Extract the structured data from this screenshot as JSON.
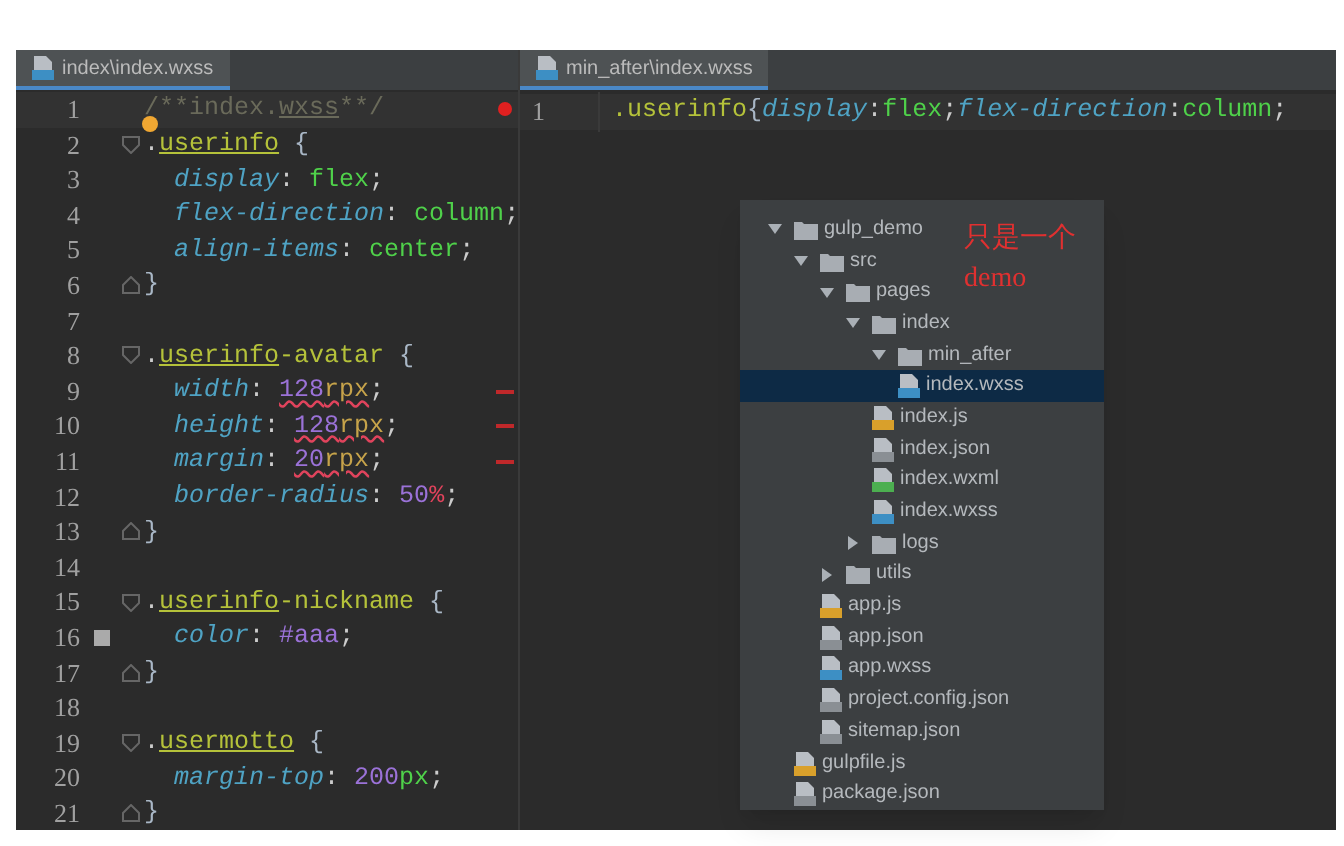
{
  "left_tab": {
    "label": "index\\index.wxss",
    "selected": true
  },
  "right_tab": {
    "label": "min_after\\index.wxss",
    "selected": true
  },
  "left_editor": {
    "lines": [
      {
        "number": "1",
        "tokens": [
          {
            "t": "/**index.",
            "kind": "comment"
          },
          {
            "t": "wxss",
            "kind": "comment_u"
          },
          {
            "t": "**/",
            "kind": "comment"
          }
        ],
        "error_dot": true
      },
      {
        "number": "2",
        "fold_start": true,
        "bookmark": true,
        "tokens": [
          {
            "t": ".",
            "kind": "punct"
          },
          {
            "t": "userinfo",
            "kind": "sel"
          },
          {
            "t": " {",
            "kind": "brace"
          }
        ]
      },
      {
        "number": "3",
        "tokens": [
          {
            "t": "  display",
            "kind": "prop"
          },
          {
            "t": ": ",
            "kind": "punct"
          },
          {
            "t": "flex",
            "kind": "value"
          },
          {
            "t": ";",
            "kind": "punct"
          }
        ]
      },
      {
        "number": "4",
        "tokens": [
          {
            "t": "  flex-direction",
            "kind": "prop"
          },
          {
            "t": ": ",
            "kind": "punct"
          },
          {
            "t": "column",
            "kind": "value"
          },
          {
            "t": ";",
            "kind": "punct"
          }
        ]
      },
      {
        "number": "5",
        "tokens": [
          {
            "t": "  align-items",
            "kind": "prop"
          },
          {
            "t": ": ",
            "kind": "punct"
          },
          {
            "t": "center",
            "kind": "value"
          },
          {
            "t": ";",
            "kind": "punct"
          }
        ]
      },
      {
        "number": "6",
        "fold_end": true,
        "tokens": [
          {
            "t": "}",
            "kind": "brace"
          }
        ]
      },
      {
        "number": "7"
      },
      {
        "number": "8",
        "fold_start": true,
        "tokens": [
          {
            "t": ".",
            "kind": "punct"
          },
          {
            "t": "userinfo",
            "kind": "sel"
          },
          {
            "t": "-avatar",
            "kind": "sel2"
          },
          {
            "t": " {",
            "kind": "brace"
          }
        ]
      },
      {
        "number": "9",
        "change": true,
        "tokens": [
          {
            "t": "  width",
            "kind": "prop"
          },
          {
            "t": ": ",
            "kind": "punct"
          },
          {
            "t": "128",
            "kind": "num_err"
          },
          {
            "t": "rpx",
            "kind": "unit_err"
          },
          {
            "t": ";",
            "kind": "punct"
          }
        ]
      },
      {
        "number": "10",
        "change": true,
        "tokens": [
          {
            "t": "  height",
            "kind": "prop"
          },
          {
            "t": ": ",
            "kind": "punct"
          },
          {
            "t": "128",
            "kind": "num_err"
          },
          {
            "t": "rpx",
            "kind": "unit_err"
          },
          {
            "t": ";",
            "kind": "punct"
          }
        ]
      },
      {
        "number": "11",
        "change": true,
        "tokens": [
          {
            "t": "  margin",
            "kind": "prop"
          },
          {
            "t": ": ",
            "kind": "punct"
          },
          {
            "t": "20",
            "kind": "num_err"
          },
          {
            "t": "rpx",
            "kind": "unit_err"
          },
          {
            "t": ";",
            "kind": "punct"
          }
        ]
      },
      {
        "number": "12",
        "tokens": [
          {
            "t": "  border-radius",
            "kind": "prop"
          },
          {
            "t": ": ",
            "kind": "punct"
          },
          {
            "t": "50",
            "kind": "num"
          },
          {
            "t": "%",
            "kind": "pct"
          },
          {
            "t": ";",
            "kind": "punct"
          }
        ]
      },
      {
        "number": "13",
        "fold_end": true,
        "tokens": [
          {
            "t": "}",
            "kind": "brace"
          }
        ]
      },
      {
        "number": "14"
      },
      {
        "number": "15",
        "fold_start": true,
        "tokens": [
          {
            "t": ".",
            "kind": "punct"
          },
          {
            "t": "userinfo",
            "kind": "sel"
          },
          {
            "t": "-nickname",
            "kind": "sel2"
          },
          {
            "t": " {",
            "kind": "brace"
          }
        ]
      },
      {
        "number": "16",
        "color": "#aaaaaa",
        "tokens": [
          {
            "t": "  color",
            "kind": "prop"
          },
          {
            "t": ": ",
            "kind": "punct"
          },
          {
            "t": "#aaa",
            "kind": "num"
          },
          {
            "t": ";",
            "kind": "punct"
          }
        ]
      },
      {
        "number": "17",
        "fold_end": true,
        "tokens": [
          {
            "t": "}",
            "kind": "brace"
          }
        ]
      },
      {
        "number": "18"
      },
      {
        "number": "19",
        "fold_start": true,
        "tokens": [
          {
            "t": ".",
            "kind": "punct"
          },
          {
            "t": "usermotto",
            "kind": "sel"
          },
          {
            "t": " {",
            "kind": "brace"
          }
        ]
      },
      {
        "number": "20",
        "tokens": [
          {
            "t": "  margin-top",
            "kind": "prop"
          },
          {
            "t": ": ",
            "kind": "punct"
          },
          {
            "t": "200",
            "kind": "num"
          },
          {
            "t": "px",
            "kind": "value"
          },
          {
            "t": ";",
            "kind": "punct"
          }
        ]
      },
      {
        "number": "21",
        "fold_end": true,
        "tokens": [
          {
            "t": "}",
            "kind": "brace"
          }
        ]
      }
    ]
  },
  "right_editor": {
    "lines": [
      {
        "number": "1",
        "tokens": [
          {
            "t": ".userinfo",
            "kind": "sel2"
          },
          {
            "t": "{",
            "kind": "brace"
          },
          {
            "t": "display",
            "kind": "prop"
          },
          {
            "t": ":",
            "kind": "punct"
          },
          {
            "t": "flex",
            "kind": "value"
          },
          {
            "t": ";",
            "kind": "punct"
          },
          {
            "t": "flex-direction",
            "kind": "prop"
          },
          {
            "t": ":",
            "kind": "punct"
          },
          {
            "t": "column",
            "kind": "value"
          },
          {
            "t": ";",
            "kind": "punct"
          }
        ]
      }
    ]
  },
  "project_tree": {
    "items": [
      {
        "label": "gulp_demo",
        "kind": "folder",
        "expanded": true,
        "selected": false,
        "children": [
          {
            "label": "src",
            "kind": "folder",
            "expanded": true,
            "selected": false,
            "children": [
              {
                "label": "pages",
                "kind": "folder",
                "expanded": true,
                "selected": false,
                "children": [
                  {
                    "label": "index",
                    "kind": "folder",
                    "expanded": true,
                    "selected": false,
                    "children": [
                      {
                        "label": "min_after",
                        "kind": "folder",
                        "expanded": true,
                        "selected": false,
                        "children": [
                          {
                            "label": "index.wxss",
                            "kind": "css",
                            "selected": true
                          }
                        ]
                      },
                      {
                        "label": "index.js",
                        "kind": "js",
                        "selected": false
                      },
                      {
                        "label": "index.json",
                        "kind": "json",
                        "selected": false
                      },
                      {
                        "label": "index.wxml",
                        "kind": "wxml",
                        "selected": false
                      },
                      {
                        "label": "index.wxss",
                        "kind": "css",
                        "selected": false
                      }
                    ]
                  },
                  {
                    "label": "logs",
                    "kind": "folder",
                    "expanded": false,
                    "selected": false
                  }
                ]
              },
              {
                "label": "utils",
                "kind": "folder",
                "expanded": false,
                "selected": false
              },
              {
                "label": "app.js",
                "kind": "js",
                "selected": false
              },
              {
                "label": "app.json",
                "kind": "json",
                "selected": false
              },
              {
                "label": "app.wxss",
                "kind": "css",
                "selected": false
              },
              {
                "label": "project.config.json",
                "kind": "json",
                "selected": false
              },
              {
                "label": "sitemap.json",
                "kind": "json",
                "selected": false
              }
            ]
          },
          {
            "label": "gulpfile.js",
            "kind": "js",
            "selected": false
          },
          {
            "label": "package.json",
            "kind": "json",
            "selected": false
          }
        ]
      }
    ]
  },
  "annotation": [
    "只是一个",
    "demo"
  ]
}
